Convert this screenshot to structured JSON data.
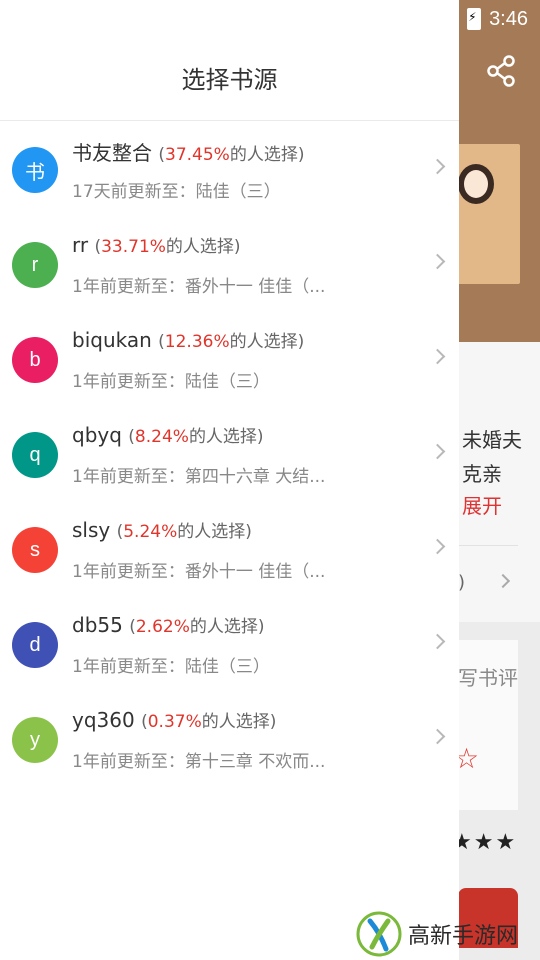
{
  "status_bar": {
    "time": "3:46",
    "battery_icon": "battery-charging-icon"
  },
  "background": {
    "text_line1": "未婚夫",
    "text_line2": "克亲",
    "expand": "展开",
    "row_number": ")",
    "review": "写书评",
    "stars": "★★★",
    "share_icon": "share-icon"
  },
  "drawer": {
    "title": "选择书源",
    "sources": [
      {
        "avatar": "书",
        "color": "#2196F3",
        "name": "书友整合",
        "percent": "37.45%",
        "suffix": "的人选择)",
        "update": "17天前更新至：陆佳（三）"
      },
      {
        "avatar": "r",
        "color": "#4CAF50",
        "name": "rr",
        "percent": "33.71%",
        "suffix": "的人选择)",
        "update": "1年前更新至：番外十一 佳佳（..."
      },
      {
        "avatar": "b",
        "color": "#E91E63",
        "name": "biqukan",
        "percent": "12.36%",
        "suffix": "的人选择)",
        "update": "1年前更新至：陆佳（三）"
      },
      {
        "avatar": "q",
        "color": "#009688",
        "name": "qbyq",
        "percent": "8.24%",
        "suffix": "的人选择)",
        "update": "1年前更新至：第四十六章 大结..."
      },
      {
        "avatar": "s",
        "color": "#F44336",
        "name": "slsy",
        "percent": "5.24%",
        "suffix": "的人选择)",
        "update": "1年前更新至：番外十一 佳佳（..."
      },
      {
        "avatar": "d",
        "color": "#3F51B5",
        "name": "db55",
        "percent": "2.62%",
        "suffix": "的人选择)",
        "update": "1年前更新至：陆佳（三）"
      },
      {
        "avatar": "y",
        "color": "#8BC34A",
        "name": "yq360",
        "percent": "0.37%",
        "suffix": "的人选择)",
        "update": "1年前更新至：第十三章 不欢而..."
      }
    ]
  },
  "watermark": {
    "text": "高新手游网"
  }
}
